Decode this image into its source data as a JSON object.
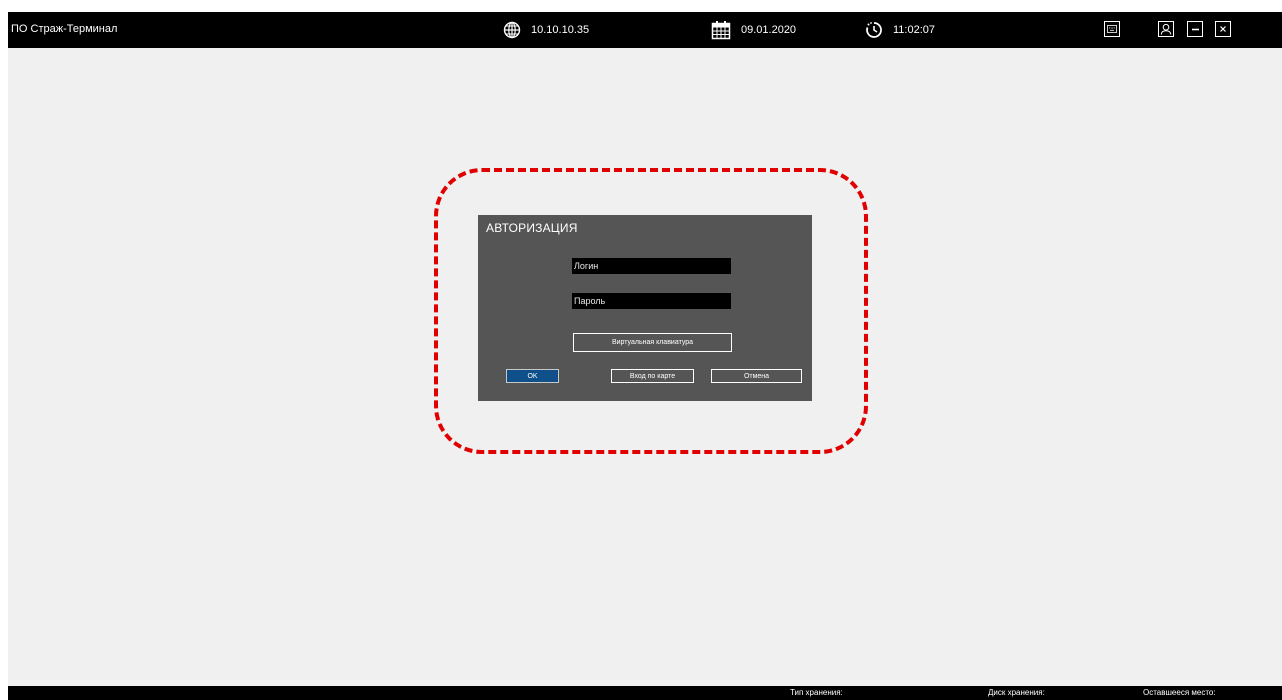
{
  "window": {
    "title": "ПО Страж-Терминал"
  },
  "header": {
    "ip": "10.10.10.35",
    "date": "09.01.2020",
    "time": "11:02:07"
  },
  "icons": {
    "ip": "globe-icon",
    "date": "calendar-icon",
    "time": "clock-icon",
    "keyboard": "keyboard-icon",
    "user": "user-icon",
    "minimize": "minimize-icon",
    "close": "close-icon"
  },
  "dialog": {
    "title": "АВТОРИЗАЦИЯ",
    "login_placeholder": "Логин",
    "password_placeholder": "Пароль",
    "virtual_keyboard_label": "Виртуальная клавиатура",
    "ok_label": "OK",
    "card_login_label": "Вход по карте",
    "cancel_label": "Отмена"
  },
  "status": {
    "storage_type": "Тип хранения:",
    "storage_disk": "Диск хранения:",
    "free_space": "Оставшееся место:"
  },
  "colors": {
    "bar": "#000000",
    "dialog_bg": "#555555",
    "ok_button": "#0f4f8a",
    "highlight": "#e00000"
  }
}
